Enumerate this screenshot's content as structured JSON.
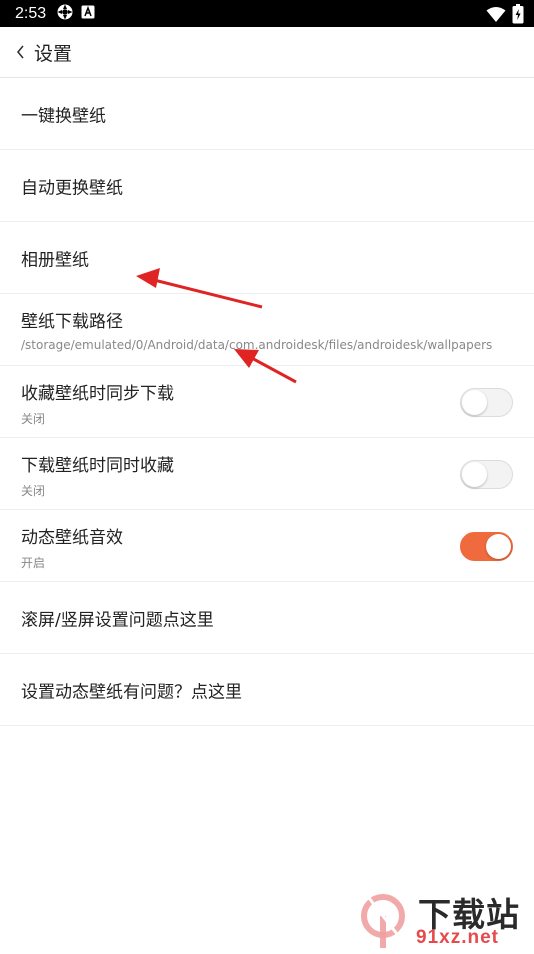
{
  "status_bar": {
    "time": "2:53",
    "icons": [
      "settings-gear-icon",
      "a-notification-icon",
      "wifi-icon",
      "battery-icon"
    ]
  },
  "header": {
    "back_icon": "chevron-left-icon",
    "title": "设置"
  },
  "settings": [
    {
      "title": "一键换壁纸"
    },
    {
      "title": "自动更换壁纸"
    },
    {
      "title": "相册壁纸"
    },
    {
      "title": "壁纸下载路径",
      "subtitle": "/storage/emulated/0/Android/data/com.androidesk/files/androidesk/wallpapers"
    },
    {
      "title": "收藏壁纸时同步下载",
      "subtitle": "关闭",
      "toggle": false
    },
    {
      "title": "下载壁纸时同时收藏",
      "subtitle": "关闭",
      "toggle": false
    },
    {
      "title": "动态壁纸音效",
      "subtitle": "开启",
      "toggle": true
    },
    {
      "title": "滚屏/竖屏设置问题点这里"
    },
    {
      "title": "设置动态壁纸有问题？点这里"
    }
  ],
  "annotations": {
    "arrow_color": "#e02424"
  },
  "watermark": {
    "logo_text": "9",
    "site_name": "下载站",
    "url": "91xz.net"
  },
  "colors": {
    "accent": "#ef6a3c",
    "toggle_off": "#f3f3f3"
  }
}
